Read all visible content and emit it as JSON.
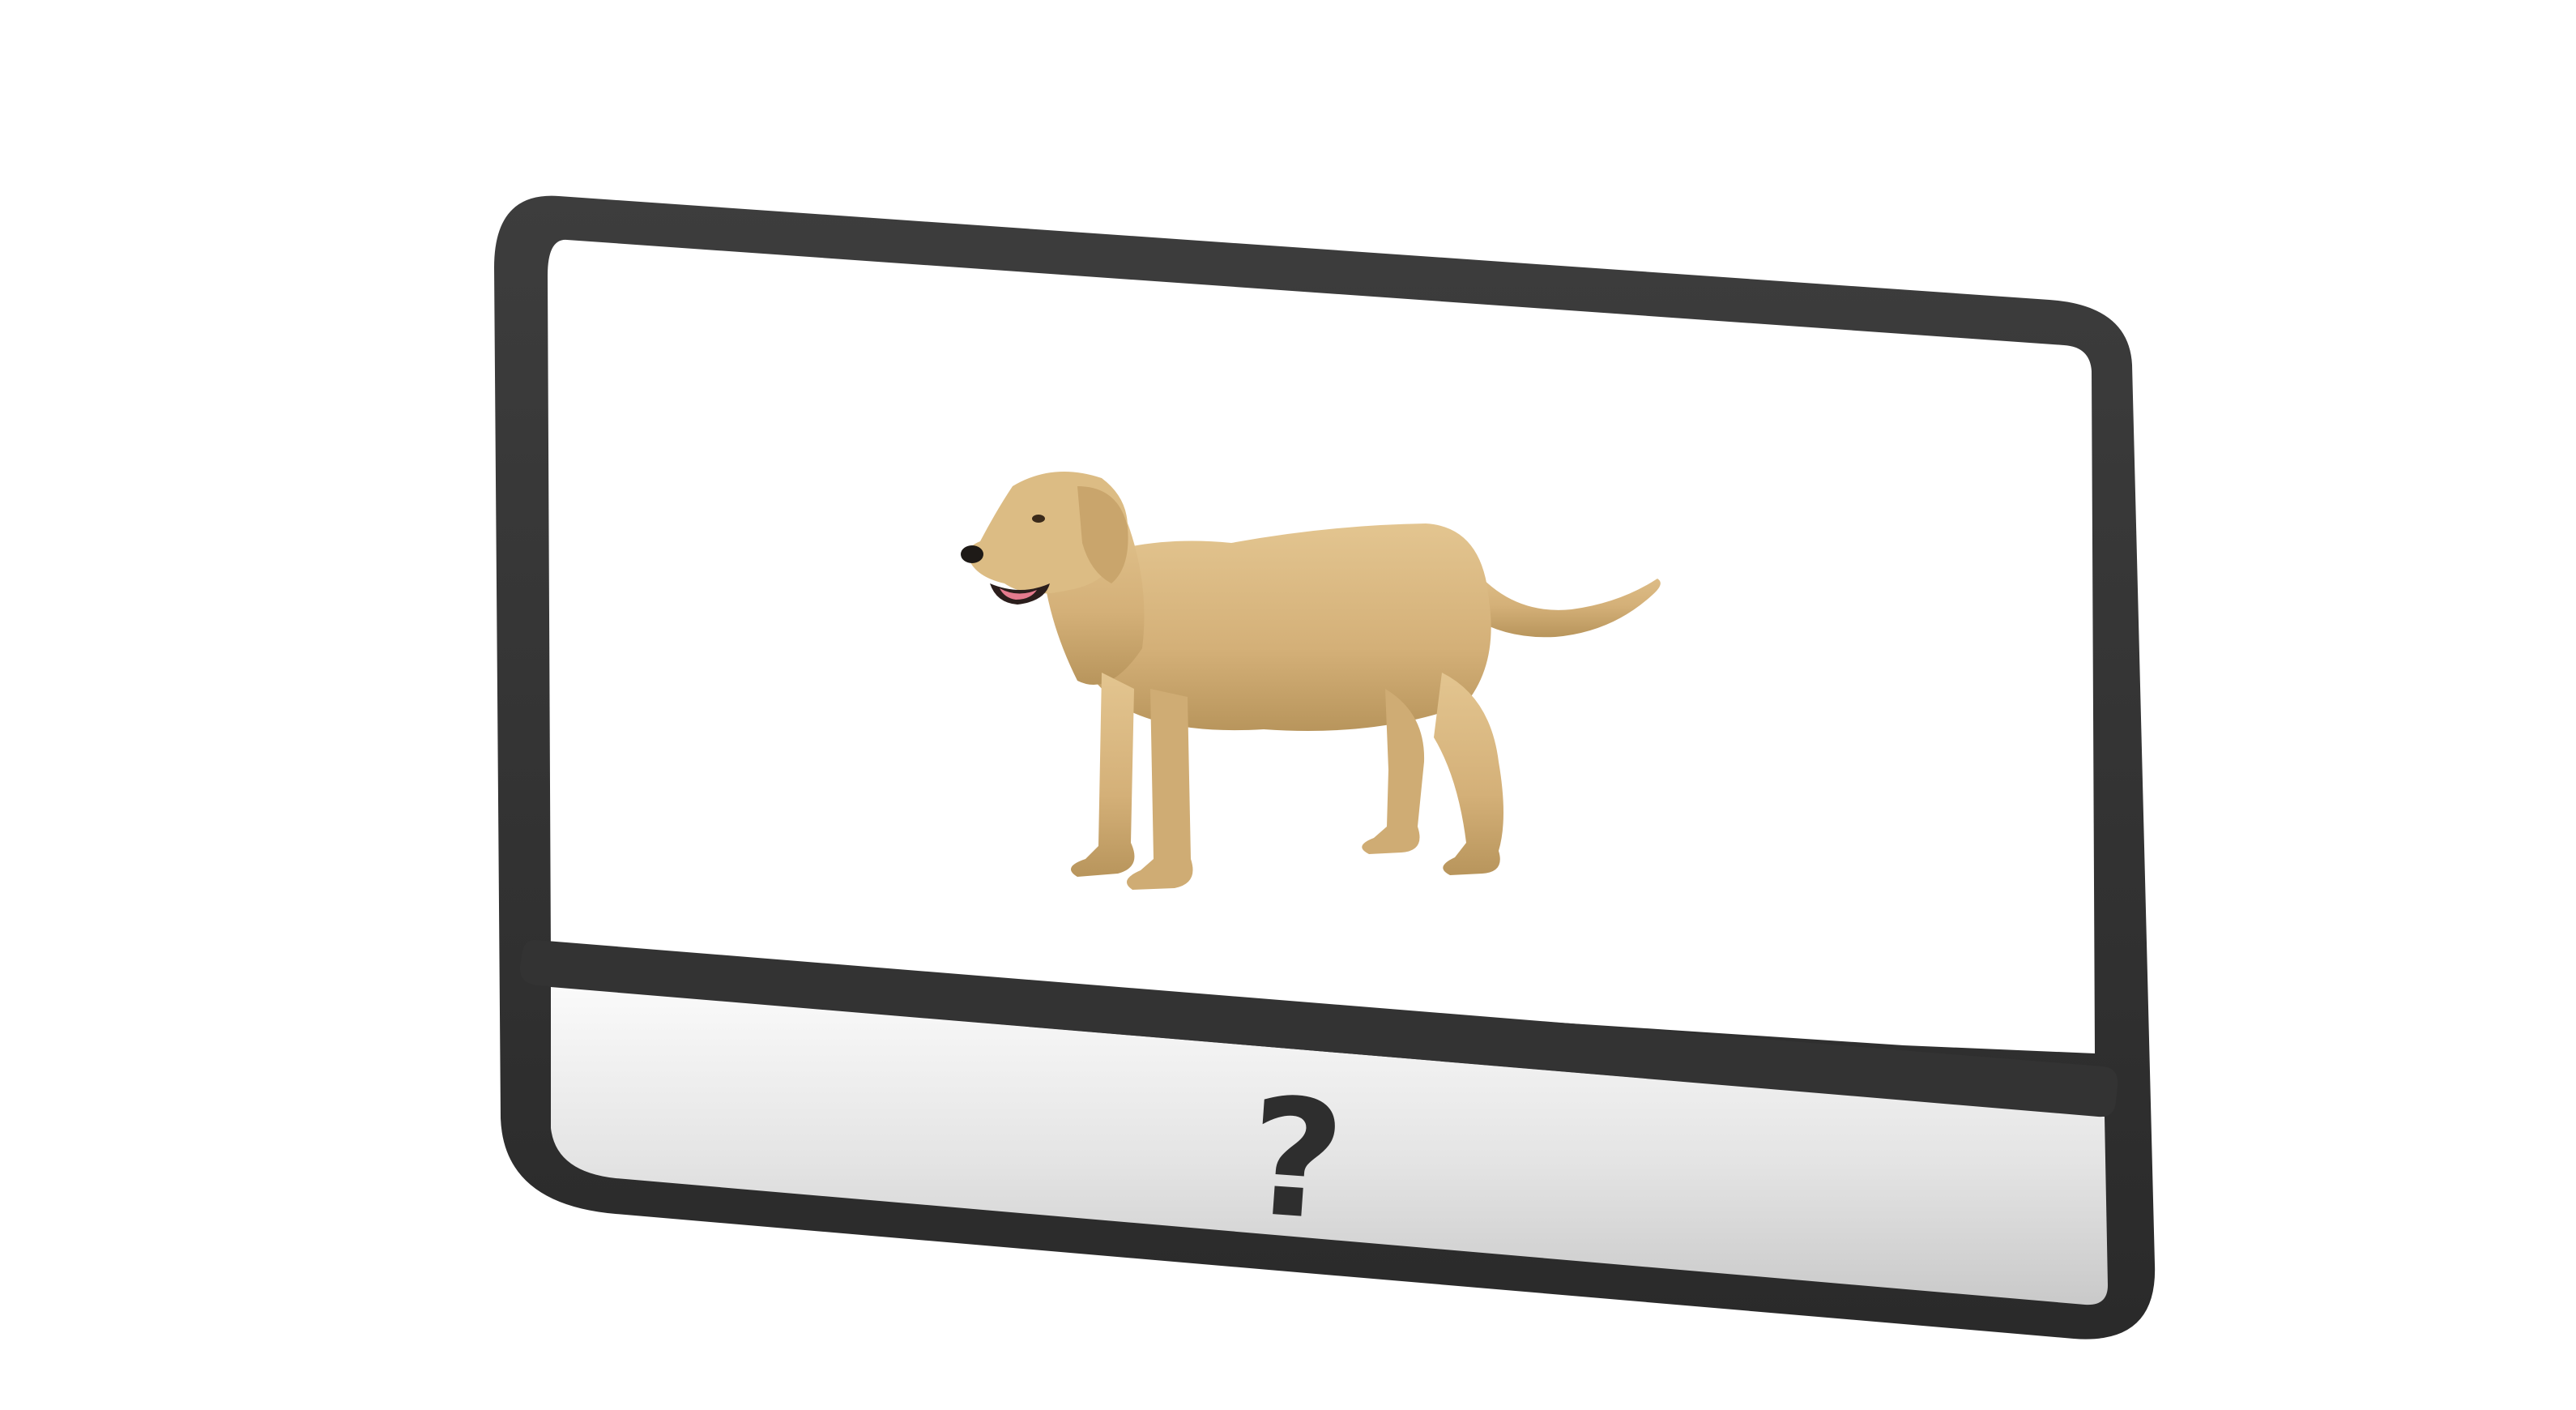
{
  "card": {
    "image_subject": "labrador-dog",
    "answer_glyph": "?",
    "colors": {
      "frame": "#333333",
      "panel": "#ffffff",
      "answer_bar_top": "#f7f7f7",
      "answer_bar_bottom": "#cfcfcf",
      "dog_body": "#d8b77e",
      "dog_shadow": "#b8955c",
      "question_mark": "#2e2e2e"
    }
  }
}
